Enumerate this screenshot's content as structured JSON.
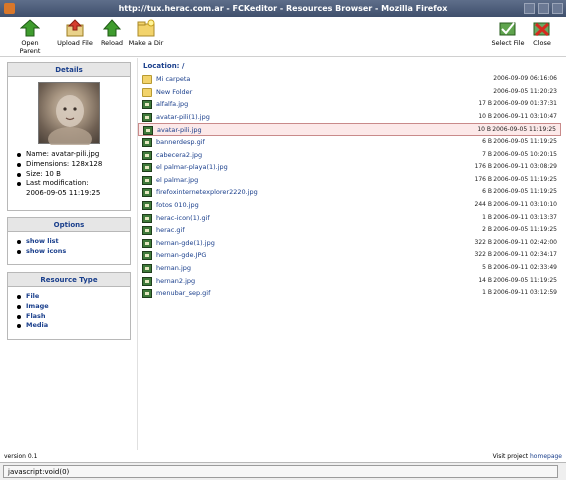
{
  "window": {
    "title": "http://tux.herac.com.ar - FCKeditor - Resources Browser - Mozilla Firefox"
  },
  "toolbar": {
    "open_parent": "Open Parent",
    "upload_file": "Upload File",
    "reload": "Reload",
    "make_dir": "Make a Dir",
    "select_file": "Select File",
    "close": "Close",
    "icons": {
      "open_parent": "green-up-arrow-icon",
      "upload_file": "upload-icon",
      "reload": "reload-icon",
      "make_dir": "new-folder-icon",
      "select_file": "select-file-icon",
      "close": "close-icon"
    }
  },
  "details": {
    "title": "Details",
    "name": "Name: avatar-pili.jpg",
    "dimensions": "Dimensions: 128x128",
    "size": "Size: 10 B",
    "last_mod_label": "Last modification:",
    "last_mod_value": "2006-09-05 11:19:25"
  },
  "options": {
    "title": "Options",
    "items": [
      "show list",
      "show icons"
    ]
  },
  "resource_type": {
    "title": "Resource Type",
    "items": [
      "File",
      "Image",
      "Flash",
      "Media"
    ]
  },
  "main": {
    "location": "Location: /",
    "files": [
      {
        "name": "Mi carpeta",
        "size": "",
        "date": "2006-09-09 06:16:06",
        "type": "folder"
      },
      {
        "name": "New Folder",
        "size": "",
        "date": "2006-09-05 11:20:23",
        "type": "folder"
      },
      {
        "name": "alfalfa.jpg",
        "size": "17 B",
        "date": "2006-09-09 01:37:31",
        "type": "image"
      },
      {
        "name": "avatar-pili(1).jpg",
        "size": "10 B",
        "date": "2006-09-11 03:10:47",
        "type": "image"
      },
      {
        "name": "avatar-pili.jpg",
        "size": "10 B",
        "date": "2006-09-05 11:19:25",
        "type": "image",
        "selected": true
      },
      {
        "name": "bannerdesp.gif",
        "size": "6 B",
        "date": "2006-09-05 11:19:25",
        "type": "image"
      },
      {
        "name": "cabecera2.jpg",
        "size": "7 B",
        "date": "2006-09-05 10:20:15",
        "type": "image"
      },
      {
        "name": "el palmar-playa(1).jpg",
        "size": "176 B",
        "date": "2006-09-11 03:08:29",
        "type": "image"
      },
      {
        "name": "el palmar.jpg",
        "size": "176 B",
        "date": "2006-09-05 11:19:25",
        "type": "image"
      },
      {
        "name": "firefoxinternetexplorer2220.jpg",
        "size": "6 B",
        "date": "2006-09-05 11:19:25",
        "type": "image"
      },
      {
        "name": "fotos 010.jpg",
        "size": "244 B",
        "date": "2006-09-11 03:10:10",
        "type": "image"
      },
      {
        "name": "herac-icon(1).gif",
        "size": "1 B",
        "date": "2006-09-11 03:13:37",
        "type": "image"
      },
      {
        "name": "herac.gif",
        "size": "2 B",
        "date": "2006-09-05 11:19:25",
        "type": "image"
      },
      {
        "name": "hernan-gde(1).jpg",
        "size": "322 B",
        "date": "2006-09-11 02:42:00",
        "type": "image"
      },
      {
        "name": "hernan-gde.JPG",
        "size": "322 B",
        "date": "2006-09-11 02:34:17",
        "type": "image"
      },
      {
        "name": "hernan.jpg",
        "size": "5 B",
        "date": "2006-09-11 02:33:49",
        "type": "image"
      },
      {
        "name": "hernan2.jpg",
        "size": "14 B",
        "date": "2006-09-05 11:19:25",
        "type": "image"
      },
      {
        "name": "menubar_sep.gif",
        "size": "1 B",
        "date": "2006-09-11 03:12:59",
        "type": "image"
      }
    ]
  },
  "footer": {
    "version": "version 0.1",
    "visit_prefix": "Visit project ",
    "visit_link": "homepage"
  },
  "statusbar": {
    "text": "javascript:void(0)"
  },
  "colors": {
    "accent": "#1a3f8c",
    "selected_bg": "#fce9e9",
    "selected_border": "#c98a8a"
  }
}
